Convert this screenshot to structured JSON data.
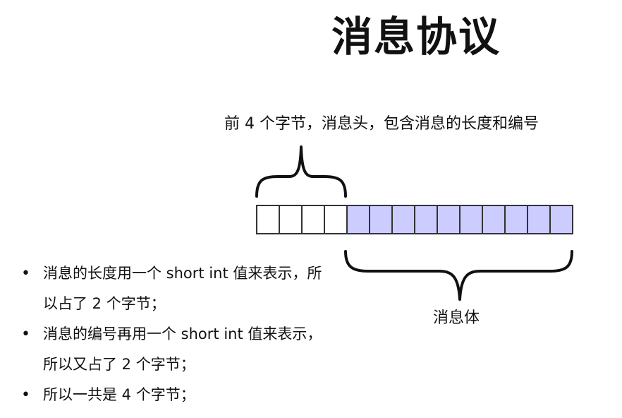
{
  "title": "消息协议",
  "diagram": {
    "header_label": "前 4 个字节，消息头，包含消息的长度和编号",
    "body_label": "消息体",
    "header_cells": 4,
    "body_cells": 10,
    "header_color": "#ffffff",
    "body_color": "#ccccff",
    "stroke_color": "#333333"
  },
  "bullets": [
    "消息的长度用一个 short int 值来表示，所以占了 2 个字节；",
    "消息的编号再用一个 short int 值来表示，所以又占了 2 个字节；",
    "所以一共是 4 个字节；"
  ]
}
